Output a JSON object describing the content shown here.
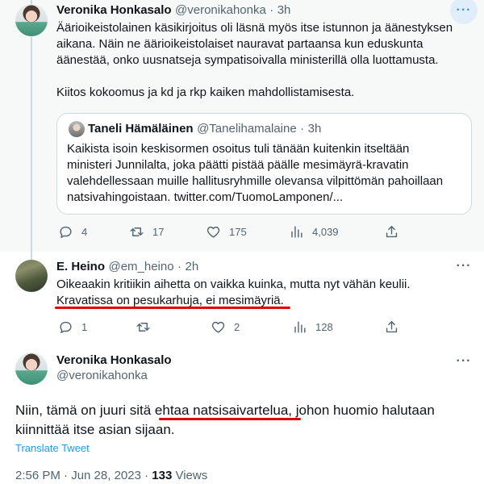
{
  "tweet1": {
    "author_name": "Veronika Honkasalo",
    "handle": "@veronikahonka",
    "time": "3h",
    "more_label": "···",
    "text_line1": "Äärioikeistolainen käsikirjoitus oli läsnä myös itse istunnon ja äänestyksen",
    "text_line2": "aikana. Näin ne äärioikeistolaiset nauravat partaansa kun eduskunta",
    "text_line3": "äänestää, onko uusnatseja sympatisoivalla ministerillä olla luottamusta.",
    "text_line4": "Kiitos kokoomus ja kd ja rkp kaiken mahdollistamisesta.",
    "quote": {
      "author_name": "Taneli Hämäläinen",
      "handle": "@Tanelihamalaine",
      "time": "3h",
      "line1": "Kaikista isoin keskisormen osoitus tuli tänään kuitenkin itseltään",
      "line2": "ministeri Junnilalta, joka päätti pistää päälle mesimäyrä-kravatin",
      "line3": "valehdellessaan muille hallitusryhmille olevansa vilpittömän pahoillaan",
      "line4": "natsivahingoistaan. twitter.com/TuomoLamponen/..."
    },
    "actions": {
      "reply_count": "4",
      "retweet_count": "17",
      "like_count": "175",
      "views_count": "4,039"
    }
  },
  "tweet2": {
    "author_name": "E. Heino",
    "handle": "@em_heino",
    "time": "2h",
    "more_label": "···",
    "text_line1": "Oikeaakin kritiikin aihetta on vaikka kuinka, mutta nyt vähän keulii.",
    "text_line2": "Kravatissa on pesukarhuja, ei mesimäyriä.",
    "actions": {
      "reply_count": "1",
      "retweet_count": "",
      "like_count": "2",
      "views_count": "128"
    }
  },
  "tweet3": {
    "author_name": "Veronika Honkasalo",
    "handle": "@veronikahonka",
    "more_label": "···",
    "text_part1": "Niin, tämä on juuri sitä ",
    "text_highlight": "ehtaa natsisaivartelua",
    "text_part2": ", johon huomio halutaan",
    "text_line2": "kiinnittää itse asian sijaan.",
    "translate_label": "Translate Tweet",
    "timestamp": "2:56 PM · Jun 28, 2023 · ",
    "views_count": "133",
    "views_label": " Views"
  },
  "colors": {
    "accent": "#1d9bf0",
    "underline": "#e00000",
    "muted": "#536471",
    "thread_line": "#cfd9de"
  }
}
